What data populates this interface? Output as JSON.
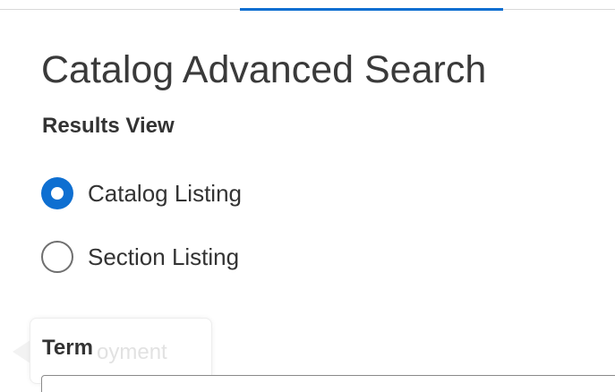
{
  "header": {
    "title": "Catalog Advanced Search"
  },
  "results_view": {
    "label": "Results View",
    "options": [
      {
        "label": "Catalog Listing",
        "checked": true
      },
      {
        "label": "Section Listing",
        "checked": false
      }
    ]
  },
  "term": {
    "label": "Term",
    "value": ""
  },
  "tooltip": {
    "text": "oyment"
  },
  "colors": {
    "accent": "#0e6fd1",
    "text": "#333333"
  }
}
